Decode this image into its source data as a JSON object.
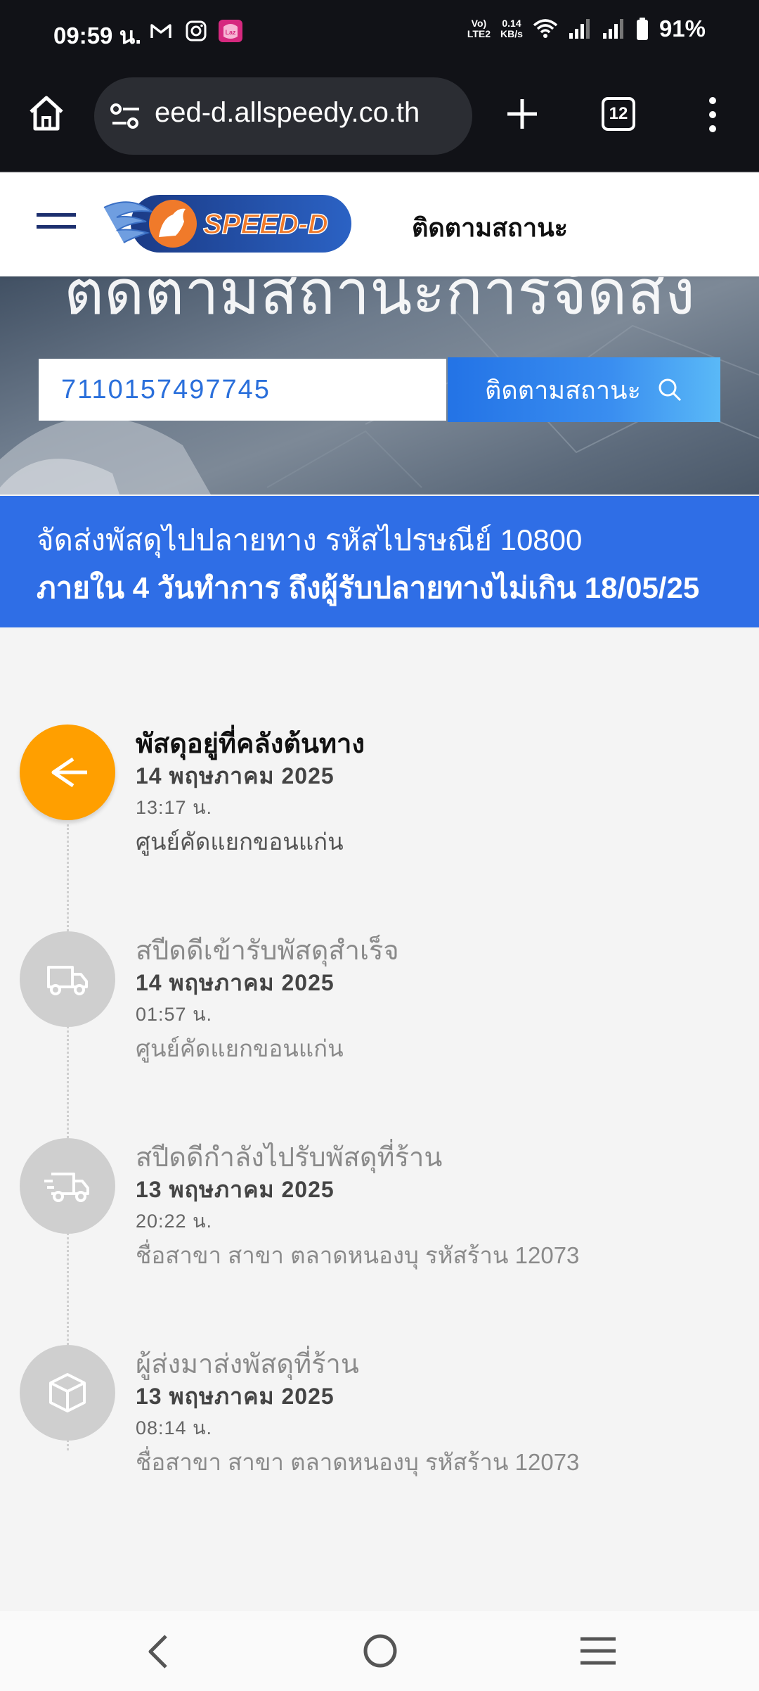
{
  "status_bar": {
    "time": "09:59 น.",
    "net_top": "0.14",
    "net_bottom": "KB/s",
    "volte_top": "Vo)",
    "volte_bottom": "LTE2",
    "battery": "91%",
    "notification_icons": [
      "gmail-icon",
      "instagram-icon",
      "lazada-icon"
    ]
  },
  "browser": {
    "url": "eed-d.allspeedy.co.th",
    "tab_count": "12"
  },
  "site_header": {
    "logo_text": "SPEED-D",
    "nav_title": "ติดตามสถานะ"
  },
  "hero": {
    "heading": "ติดตามสถานะการจัดส่ง",
    "tracking_number": "7110157497745",
    "search_button_label": "ติดตามสถานะ"
  },
  "banner": {
    "line1": "จัดส่งพัสดุไปปลายทาง รหัสไปรษณีย์ 10800",
    "line2": "ภายใน 4 วันทำการ ถึงผู้รับปลายทางไม่เกิน 18/05/25"
  },
  "events": [
    {
      "title": "พัสดุอยู่ที่คลังต้นทาง",
      "date": "14 พฤษภาคม 2025",
      "time": "13:17 น.",
      "location": "ศูนย์คัดแยกขอนแก่น",
      "icon": "warehouse-arrow-icon",
      "active": true
    },
    {
      "title": "สปีดดีเข้ารับพัสดุสำเร็จ",
      "date": "14 พฤษภาคม 2025",
      "time": "01:57 น.",
      "location": "ศูนย์คัดแยกขอนแก่น",
      "icon": "truck-icon",
      "active": false
    },
    {
      "title": "สปีดดีกำลังไปรับพัสดุที่ร้าน",
      "date": "13 พฤษภาคม 2025",
      "time": "20:22 น.",
      "location": "ชื่อสาขา สาขา ตลาดหนองบุ รหัสร้าน 12073",
      "icon": "moving-truck-icon",
      "active": false
    },
    {
      "title": "ผู้ส่งมาส่งพัสดุที่ร้าน",
      "date": "13 พฤษภาคม 2025",
      "time": "08:14 น.",
      "location": "ชื่อสาขา สาขา ตลาดหนองบุ รหัสร้าน 12073",
      "icon": "package-box-icon",
      "active": false
    }
  ],
  "colors": {
    "banner": "#2f6ee6",
    "active_step": "#ff9f00",
    "inactive_step": "#cfcfcf",
    "search_button": "#2373e6"
  }
}
